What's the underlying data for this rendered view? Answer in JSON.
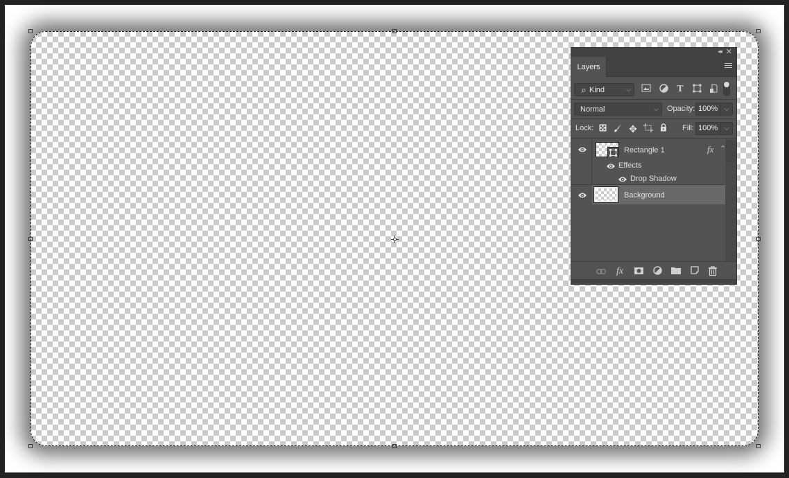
{
  "canvas": {
    "background": "transparent-checkerboard",
    "selection": "rounded-rectangle-marquee"
  },
  "layers_panel": {
    "tab_label": "Layers",
    "collapse_icon": "double-chevron-left-icon",
    "close_icon": "close-icon",
    "menu_icon": "hamburger-menu-icon",
    "filter": {
      "kind_label": "Kind",
      "icons": [
        "image-filter-icon",
        "adjustment-filter-icon",
        "type-filter-icon",
        "shape-filter-icon",
        "smart-object-filter-icon",
        "filter-toggle-icon"
      ]
    },
    "blend_mode": "Normal",
    "opacity_label": "Opacity:",
    "opacity_value": "100%",
    "lock_label": "Lock:",
    "lock_icons": [
      "lock-transparent-pixels-icon",
      "lock-image-pixels-icon",
      "lock-position-icon",
      "lock-artboard-icon",
      "lock-all-icon"
    ],
    "fill_label": "Fill:",
    "fill_value": "100%",
    "layers": [
      {
        "name": "Rectangle 1",
        "visible": true,
        "has_fx": true,
        "fx_label": "fx",
        "selected": false
      },
      {
        "name": "Effects",
        "visible": true,
        "type": "effects-group"
      },
      {
        "name": "Drop Shadow",
        "visible": true,
        "type": "effect"
      },
      {
        "name": "Background",
        "visible": true,
        "selected": true
      }
    ],
    "footer_icons": [
      "link-layers-icon",
      "add-layer-style-icon",
      "add-mask-icon",
      "new-adjustment-layer-icon",
      "new-group-icon",
      "new-layer-icon",
      "delete-layer-icon"
    ],
    "colors": {
      "panel_bg": "#535353",
      "selected_row": "#696969",
      "topbar": "#424242"
    }
  }
}
